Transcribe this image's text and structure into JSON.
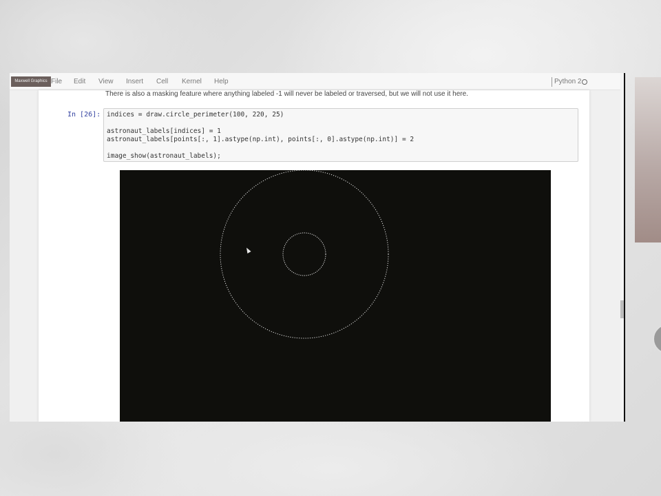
{
  "app_badge": "Maxwell Graphics",
  "menu": [
    "File",
    "Edit",
    "View",
    "Insert",
    "Cell",
    "Kernel",
    "Help"
  ],
  "kernel": {
    "name": "Python 2",
    "status_icon": "kernel-idle-circle-icon"
  },
  "markdown_text": "There is also a masking feature where anything labeled -1 will never be labeled or traversed, but we will not use it here.",
  "cell": {
    "prompt": "In [26]:",
    "code_lines": [
      "indices = draw.circle_perimeter(100, 220, 25)",
      "",
      "astronaut_labels[indices] = 1",
      "astronaut_labels[points[:, 1].astype(np.int), points[:, 0].astype(np.int)] = 2",
      "",
      "image_show(astronaut_labels);"
    ]
  },
  "figure": {
    "background": "#0f0f0c",
    "stroke": "#e6e6e6",
    "description_none": ""
  }
}
